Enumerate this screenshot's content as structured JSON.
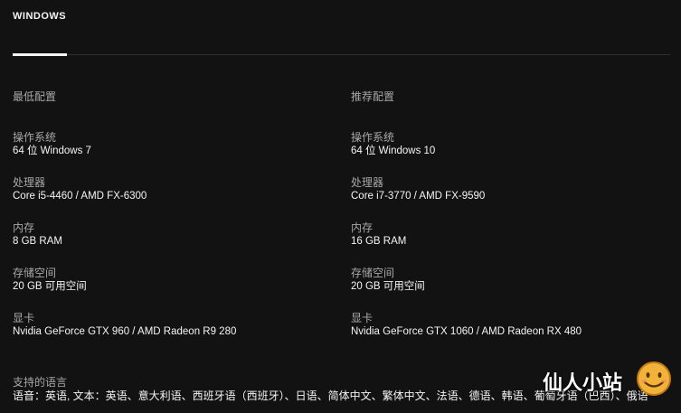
{
  "tab": {
    "label": "WINDOWS"
  },
  "min": {
    "title": "最低配置",
    "specs": [
      {
        "label": "操作系统",
        "value": "64 位 Windows 7"
      },
      {
        "label": "处理器",
        "value": "Core i5-4460 / AMD FX-6300"
      },
      {
        "label": "内存",
        "value": "8 GB RAM"
      },
      {
        "label": "存储空间",
        "value": "20 GB 可用空间"
      },
      {
        "label": "显卡",
        "value": "Nvidia GeForce GTX 960 / AMD Radeon R9 280"
      }
    ]
  },
  "rec": {
    "title": "推荐配置",
    "specs": [
      {
        "label": "操作系统",
        "value": "64 位 Windows 10"
      },
      {
        "label": "处理器",
        "value": "Core i7-3770 / AMD FX-9590"
      },
      {
        "label": "内存",
        "value": "16 GB RAM"
      },
      {
        "label": "存储空间",
        "value": "20 GB 可用空间"
      },
      {
        "label": "显卡",
        "value": "Nvidia GeForce GTX 1060 / AMD Radeon RX 480"
      }
    ]
  },
  "languages": {
    "title": "支持的语言",
    "text": "语音：英语, 文本：英语、意大利语、西班牙语（西班牙）、日语、简体中文、繁体中文、法语、德语、韩语、葡萄牙语（巴西）、俄语"
  },
  "watermark": {
    "text": "仙人小站"
  },
  "colors": {
    "background": "#121212",
    "label": "#a8a8a8",
    "text": "#f5f5f5"
  }
}
